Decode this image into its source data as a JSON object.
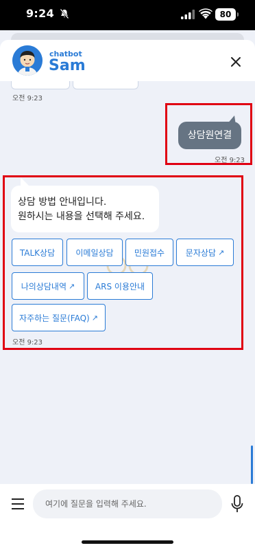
{
  "status_bar": {
    "time": "9:24",
    "battery": "80"
  },
  "header": {
    "subtitle": "chatbot",
    "title": "Sam"
  },
  "chat": {
    "prev_timestamp": "오전 9:23",
    "user_message": {
      "text": "상담원연결",
      "timestamp": "오전 9:23"
    },
    "bot_message": {
      "line1": "상담 방법 안내입니다.",
      "line2": "원하시는 내용을 선택해 주세요.",
      "timestamp": "오전 9:23",
      "options": [
        {
          "label": "TALK상담",
          "external": false
        },
        {
          "label": "이메일상담",
          "external": false
        },
        {
          "label": "민원접수",
          "external": false
        },
        {
          "label": "문자상담",
          "external": true
        },
        {
          "label": "나의상담내역",
          "external": true
        },
        {
          "label": "ARS 이용안내",
          "external": false
        },
        {
          "label": "자주하는 질문(FAQ)",
          "external": true
        }
      ]
    },
    "highlight_color": "#e00012"
  },
  "input": {
    "placeholder": "여기에 질문을 입력해 주세요."
  },
  "colors": {
    "accent": "#2a7bd6",
    "user_bubble": "#667483",
    "background": "#eef1f8"
  },
  "icons": [
    "bell-off-icon",
    "signal-icon",
    "wifi-icon",
    "close-icon",
    "menu-icon",
    "mic-icon",
    "external-link-icon"
  ]
}
